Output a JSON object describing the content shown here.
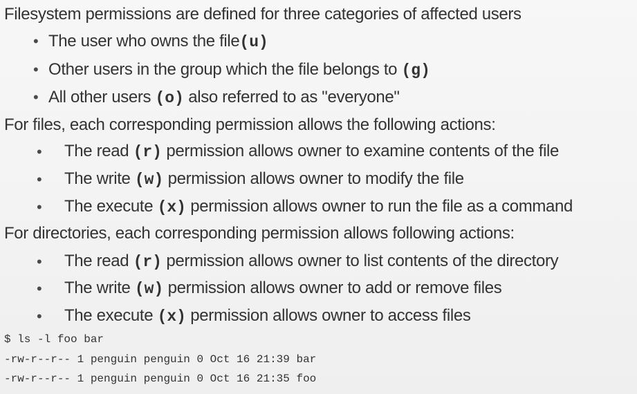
{
  "heading1": "Filesystem permissions are defined for three categories of affected users",
  "categories": [
    {
      "pre": "The user who owns the file",
      "code": "(u)",
      "post": ""
    },
    {
      "pre": "Other users in the group which the file belongs to ",
      "code": "(g)",
      "post": ""
    },
    {
      "pre": "All other users ",
      "code": "(o)",
      "post": " also referred to as \"everyone\""
    }
  ],
  "heading2": "For files, each corresponding permission allows the following actions:",
  "file_perms": [
    {
      "pre": "The read ",
      "code": "(r)",
      "post": " permission allows owner to examine contents of the file"
    },
    {
      "pre": "The write ",
      "code": "(w)",
      "post": " permission allows owner to modify the file"
    },
    {
      "pre": "The execute ",
      "code": "(x)",
      "post": " permission allows owner to run the file as a command"
    }
  ],
  "heading3": "For directories, each corresponding permission allows following actions:",
  "dir_perms": [
    {
      "pre": "The read ",
      "code": "(r)",
      "post": " permission allows owner to list contents of the directory"
    },
    {
      "pre": "The write ",
      "code": "(w)",
      "post": " permission allows owner to add or remove files"
    },
    {
      "pre": "The execute ",
      "code": "(x)",
      "post": " permission allows owner to access files"
    }
  ],
  "terminal": {
    "command": "$ ls -l foo bar",
    "lines": [
      "-rw-r--r-- 1 penguin penguin 0 Oct 16 21:39 bar",
      "-rw-r--r-- 1 penguin penguin 0 Oct 16 21:35 foo"
    ]
  }
}
